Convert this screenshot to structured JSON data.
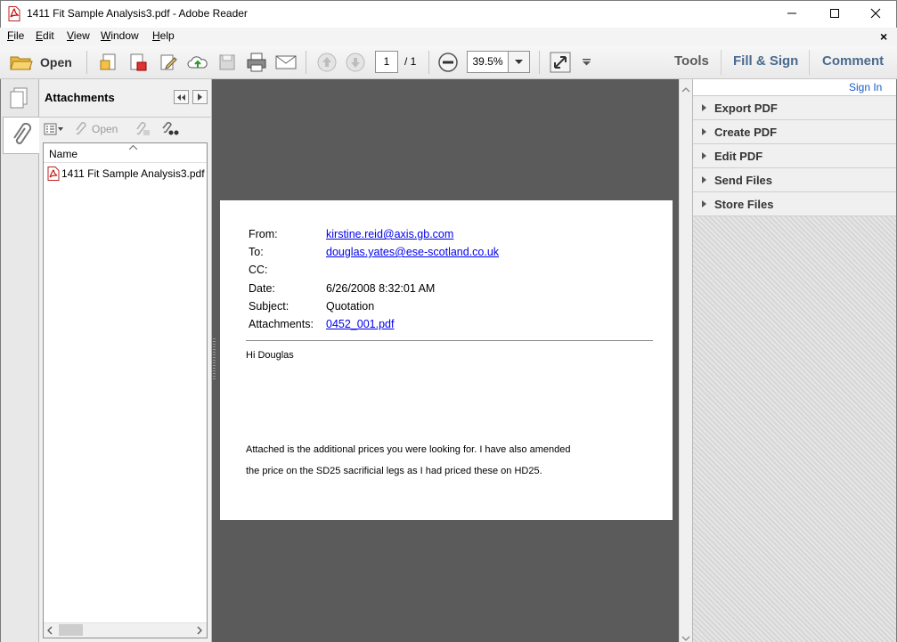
{
  "window": {
    "title": "1411 Fit Sample Analysis3.pdf - Adobe Reader"
  },
  "menu": {
    "items": [
      {
        "label": "File",
        "accel": "F"
      },
      {
        "label": "Edit",
        "accel": "E"
      },
      {
        "label": "View",
        "accel": "V"
      },
      {
        "label": "Window",
        "accel": "W"
      },
      {
        "label": "Help",
        "accel": "H"
      }
    ],
    "close_glyph": "×"
  },
  "toolbar": {
    "open_label": "Open",
    "page_current": "1",
    "page_total": "/ 1",
    "zoom": "39.5%",
    "tools_label": "Tools",
    "fillsign_label": "Fill & Sign",
    "comment_label": "Comment"
  },
  "attachments_panel": {
    "title": "Attachments",
    "open_label": "Open",
    "column_name": "Name",
    "files": [
      "1411 Fit Sample Analysis3.pdf"
    ]
  },
  "email": {
    "headers": [
      {
        "label": "From:",
        "value": "kirstine.reid@axis.gb.com",
        "link": true
      },
      {
        "label": "To:",
        "value": "douglas.yates@ese-scotland.co.uk",
        "link": true
      },
      {
        "label": "CC:",
        "value": "",
        "link": false
      },
      {
        "label": "Date:",
        "value": "6/26/2008 8:32:01 AM",
        "link": false
      },
      {
        "label": "Subject:",
        "value": "Quotation",
        "link": false
      },
      {
        "label": "Attachments:",
        "value": "0452_001.pdf",
        "link": true
      }
    ],
    "greeting": "Hi Douglas",
    "body_lines": [
      "Attached is the additional prices you were looking for.  I have also amended",
      "the price on the SD25 sacrificial legs as I had priced these on HD25."
    ]
  },
  "right_pane": {
    "sign_in": "Sign In",
    "items": [
      "Export PDF",
      "Create PDF",
      "Edit PDF",
      "Send Files",
      "Store Files"
    ]
  },
  "colors": {
    "link": "#0000ee",
    "accent": "#4a6a8e",
    "doc_background": "#5b5b5b"
  }
}
